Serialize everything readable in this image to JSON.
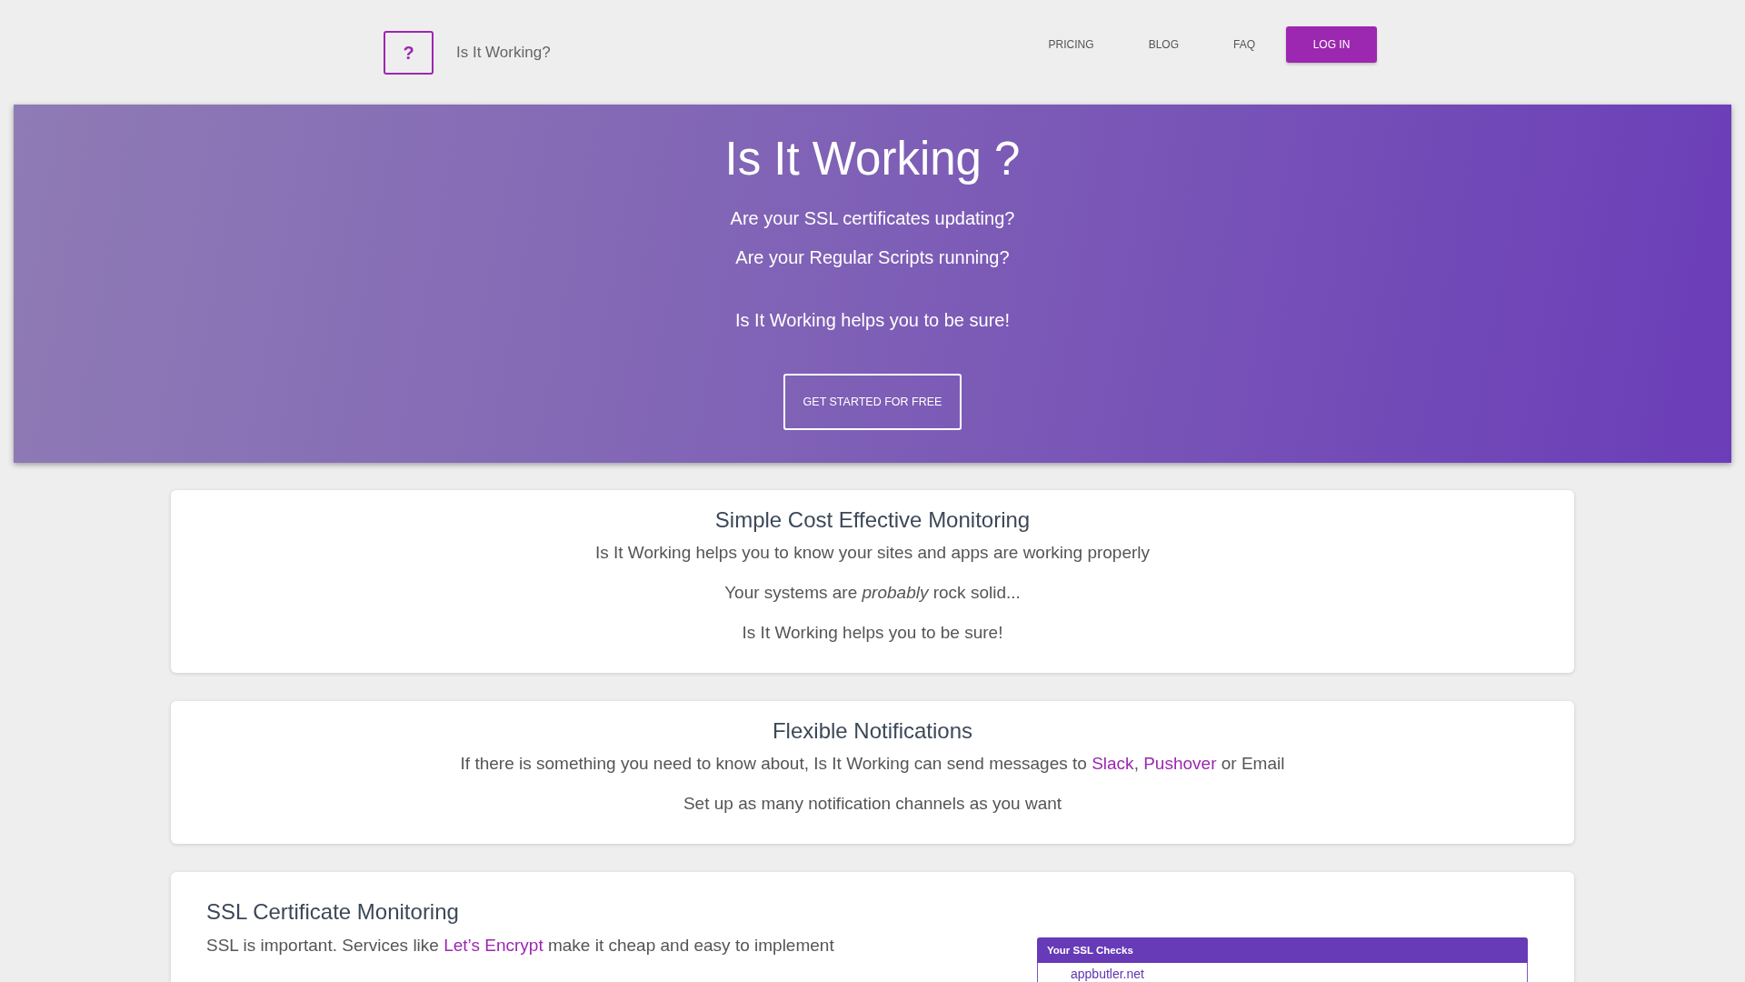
{
  "header": {
    "logo_mark": "?",
    "site_name": "Is It Working?",
    "nav": [
      {
        "label": "PRICING",
        "kind": "link"
      },
      {
        "label": "BLOG",
        "kind": "link"
      },
      {
        "label": "FAQ",
        "kind": "link"
      },
      {
        "label": "LOG IN",
        "kind": "button"
      }
    ]
  },
  "hero": {
    "title": "Is It Working ?",
    "lines": [
      "Are your SSL certificates updating?",
      "Are your Regular Scripts running?"
    ],
    "tagline": "Is It Working helps you to be sure!",
    "cta": "GET STARTED FOR FREE"
  },
  "sections": [
    {
      "kind": "centered",
      "heading": "Simple Cost Effective Monitoring",
      "paragraphs": [
        [
          {
            "kind": "text",
            "text": "Is It Working helps you to know your sites and apps are working properly"
          }
        ],
        [
          {
            "kind": "text",
            "text": "Your systems are *probably* rock solid..."
          }
        ],
        [
          {
            "kind": "text",
            "text": "Is It Working helps you to be sure!"
          }
        ]
      ]
    },
    {
      "kind": "centered",
      "heading": "Flexible Notifications",
      "paragraphs": [
        [
          {
            "kind": "text",
            "text": "If there is something you need to know about, Is It Working can send messages to "
          },
          {
            "kind": "link",
            "text": "Slack"
          },
          {
            "kind": "text",
            "text": ", "
          },
          {
            "kind": "link",
            "text": "Pushover"
          },
          {
            "kind": "text",
            "text": " or Email"
          }
        ],
        [
          {
            "kind": "text",
            "text": "Set up as many notification channels as you want"
          }
        ]
      ]
    },
    {
      "kind": "split",
      "heading": "SSL Certificate Monitoring",
      "paragraphs": [
        [
          {
            "kind": "text",
            "text": "SSL is important. Services like "
          },
          {
            "kind": "link",
            "text": "Let’s Encrypt"
          },
          {
            "kind": "text",
            "text": " make it cheap and easy to implement"
          }
        ]
      ],
      "panel": {
        "title": "Your SSL Checks",
        "rows": [
          "appbutler.net"
        ]
      }
    }
  ]
}
